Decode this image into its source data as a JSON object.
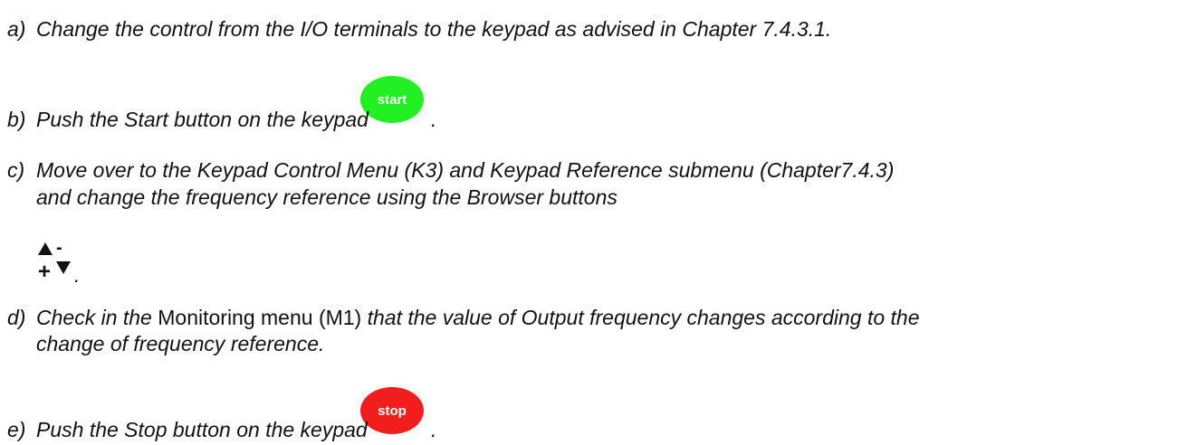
{
  "steps": {
    "a": {
      "marker": "a)",
      "text": "Change the control from the I/O terminals to the keypad as advised in Chapter 7.4.3.1."
    },
    "b": {
      "marker": "b)",
      "text": "Push the Start button on the keypad",
      "end": "."
    },
    "c": {
      "marker": "c)",
      "line1": "Move over to the Keypad Control Menu (K3) and Keypad Reference submenu (Chapter7.4.3)",
      "line2": "and change the frequency reference using the Browser buttons",
      "end": "."
    },
    "d": {
      "marker": "d)",
      "pre": "Check in the ",
      "menu": "Monitoring menu (M1)",
      "post": " that the value of Output frequency changes according to the",
      "line2": "change of frequency reference."
    },
    "e": {
      "marker": "e)",
      "text": "Push the Stop button on the keypad",
      "end": "."
    }
  },
  "buttons": {
    "start": {
      "label": "start",
      "color": "#22f022"
    },
    "stop": {
      "label": "stop",
      "color": "#f21e1e"
    },
    "browser": {
      "plus": "+",
      "minus": "-",
      "up_icon": "triangle-up",
      "down_icon": "triangle-down"
    }
  }
}
